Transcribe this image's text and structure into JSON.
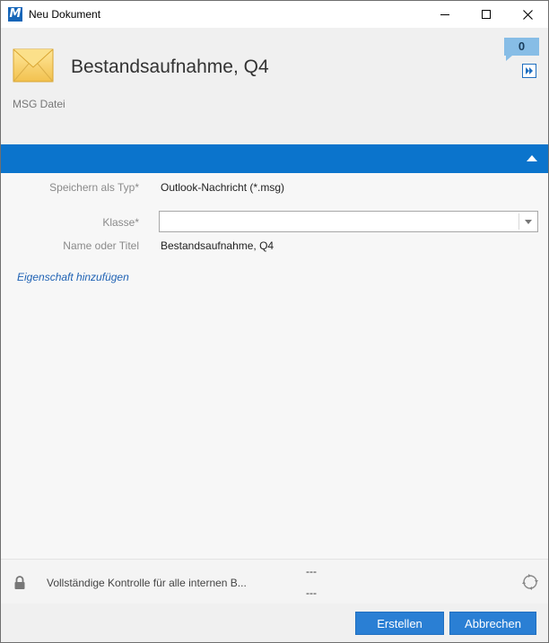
{
  "window": {
    "title": "Neu Dokument",
    "app_logo_letter": "M"
  },
  "header": {
    "document_title": "Bestandsaufnahme, Q4",
    "document_type": "MSG Datei",
    "counter": "0",
    "accent_color": "#0b74cc"
  },
  "form": {
    "fields": [
      {
        "label": "Speichern als Typ*",
        "value": "Outlook-Nachricht (*.msg)"
      },
      {
        "label": "Klasse*",
        "value": ""
      },
      {
        "label": "Name oder Titel",
        "value": "Bestandsaufnahme, Q4"
      }
    ],
    "add_property_link": "Eigenschaft hinzufügen"
  },
  "status": {
    "permission_text": "Vollständige Kontrolle für alle internen B...",
    "line1": "---",
    "line2": "---"
  },
  "footer": {
    "create_label": "Erstellen",
    "cancel_label": "Abbrechen"
  },
  "icons": {
    "document": "envelope-icon",
    "forward": "fast-forward-icon",
    "collapse": "chevron-up-icon",
    "lock": "lock-icon",
    "sync": "sync-icon"
  }
}
